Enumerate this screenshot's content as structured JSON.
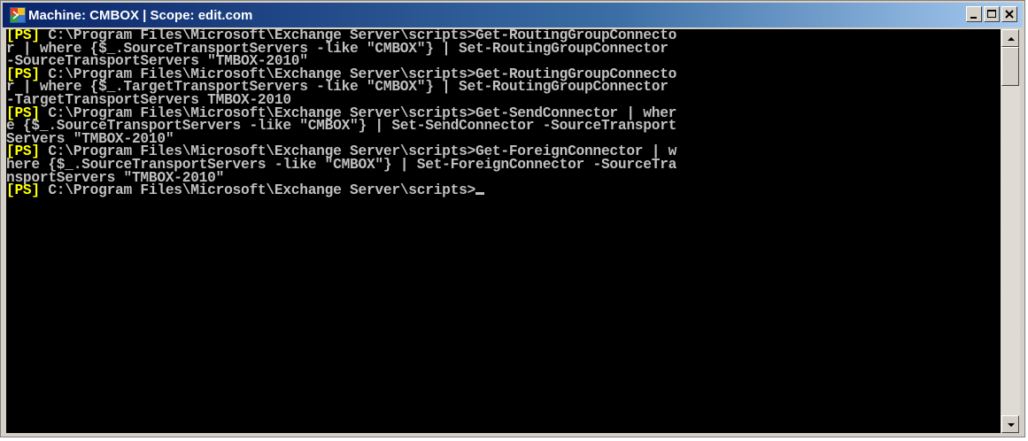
{
  "window": {
    "title": "Machine: CMBOX | Scope: edit.com",
    "icon": "powershell-console-icon",
    "buttons": [
      "minimize-icon",
      "maximize-icon",
      "close-icon"
    ]
  },
  "console": {
    "colors": {
      "background": "#000000",
      "text": "#c0c0c0",
      "prompt_tag": "#ffff00"
    },
    "lines": [
      {
        "tag": "[PS]",
        "text": " C:\\Program Files\\Microsoft\\Exchange Server\\scripts>Get-RoutingGroupConnecto"
      },
      {
        "tag": "",
        "text": "r | where {$_.SourceTransportServers -like \"CMBOX\"} | Set-RoutingGroupConnector"
      },
      {
        "tag": "",
        "text": "-SourceTransportServers \"TMBOX-2010\""
      },
      {
        "tag": "[PS]",
        "text": " C:\\Program Files\\Microsoft\\Exchange Server\\scripts>Get-RoutingGroupConnecto"
      },
      {
        "tag": "",
        "text": "r | where {$_.TargetTransportServers -like \"CMBOX\"} | Set-RoutingGroupConnector"
      },
      {
        "tag": "",
        "text": "-TargetTransportServers TMBOX-2010"
      },
      {
        "tag": "[PS]",
        "text": " C:\\Program Files\\Microsoft\\Exchange Server\\scripts>Get-SendConnector | wher"
      },
      {
        "tag": "",
        "text": "e {$_.SourceTransportServers -like \"CMBOX\"} | Set-SendConnector -SourceTransport"
      },
      {
        "tag": "",
        "text": "Servers \"TMBOX-2010\""
      },
      {
        "tag": "[PS]",
        "text": " C:\\Program Files\\Microsoft\\Exchange Server\\scripts>Get-ForeignConnector | w"
      },
      {
        "tag": "",
        "text": "here {$_.SourceTransportServers -like \"CMBOX\"} | Set-ForeignConnector -SourceTra"
      },
      {
        "tag": "",
        "text": "nsportServers \"TMBOX-2010\""
      },
      {
        "tag": "[PS]",
        "text": " C:\\Program Files\\Microsoft\\Exchange Server\\scripts>"
      }
    ]
  },
  "scrollbar": {
    "up_icon": "scroll-up-arrow-icon",
    "down_icon": "scroll-down-arrow-icon"
  }
}
